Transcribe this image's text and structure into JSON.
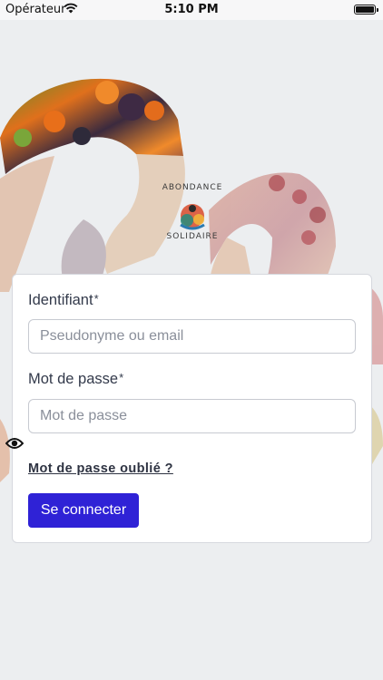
{
  "status_bar": {
    "carrier": "Opérateur",
    "time": "5:10 PM"
  },
  "logo": {
    "line_top": "ABONDANCE",
    "line_bottom": "SOLIDAIRE"
  },
  "form": {
    "identifier_label": "Identifiant",
    "identifier_required": "*",
    "identifier_placeholder": "Pseudonyme ou email",
    "password_label": "Mot de passe",
    "password_required": "*",
    "password_placeholder": "Mot de passe",
    "forgot_link": "Mot de passe oublié ?",
    "submit_label": "Se connecter"
  },
  "icons": {
    "wifi": "wifi-icon",
    "battery": "battery-icon",
    "eye": "eye-icon"
  },
  "colors": {
    "accent": "#2f22d6",
    "background": "#eceef0"
  }
}
